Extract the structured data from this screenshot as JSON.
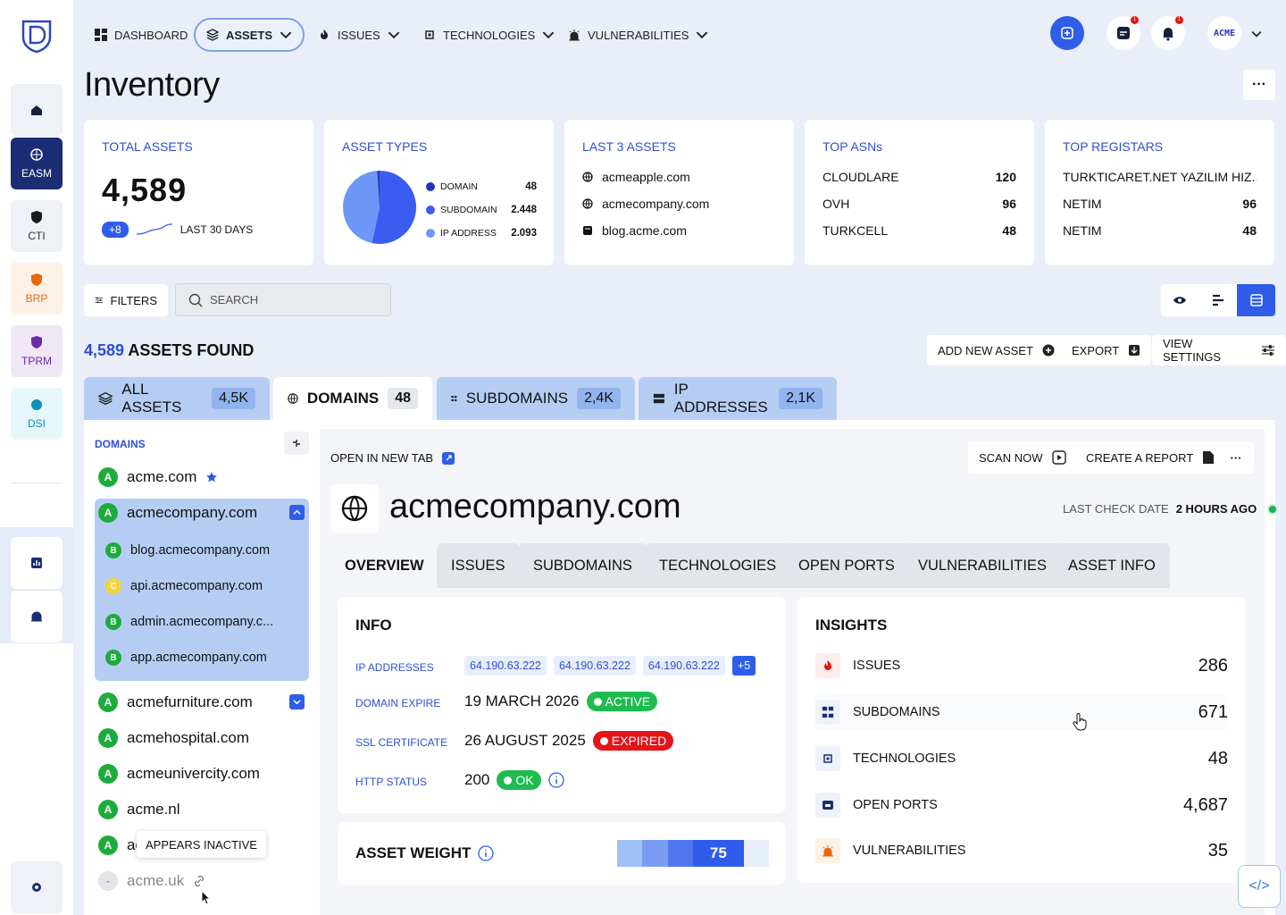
{
  "sidebar": {
    "items": [
      {
        "label": ""
      },
      {
        "label": "EASM"
      },
      {
        "label": "CTI"
      },
      {
        "label": "BRP"
      },
      {
        "label": "TPRM"
      },
      {
        "label": "DSI"
      }
    ]
  },
  "topnav": {
    "dashboard": "DASHBOARD",
    "assets": "ASSETS",
    "issues": "ISSUES",
    "technologies": "TECHNOLOGIES",
    "vulnerabilities": "VULNERABILITIES",
    "msg_badge": "1",
    "bell_badge": "1",
    "avatar": "ACME"
  },
  "page": {
    "title": "Inventory"
  },
  "cards": {
    "total": {
      "title": "TOTAL ASSETS",
      "value": "4,589",
      "delta": "+8",
      "period": "LAST 30 DAYS"
    },
    "types": {
      "title": "ASSET TYPES",
      "rows": [
        {
          "label": "DOMAIN",
          "value": "48",
          "color": "#2236b8"
        },
        {
          "label": "SUBDOMAIN",
          "value": "2.448",
          "color": "#3a5cf0"
        },
        {
          "label": "IP ADDRESS",
          "value": "2.093",
          "color": "#6d96f6"
        }
      ]
    },
    "last3": {
      "title": "LAST 3 ASSETS",
      "items": [
        "acmeapple.com",
        "acmecompany.com",
        "blog.acme.com"
      ]
    },
    "asns": {
      "title": "TOP ASNs",
      "rows": [
        {
          "name": "CLOUDLARE",
          "value": "120"
        },
        {
          "name": "OVH",
          "value": "96"
        },
        {
          "name": "TURKCELL",
          "value": "48"
        }
      ]
    },
    "registrars": {
      "title": "TOP REGISTARS",
      "rows": [
        {
          "name": "TURKTICARET.NET YAZILIM HIZ...",
          "value": "NETIM 96"
        },
        {
          "name": "NETIM",
          "value": "96"
        },
        {
          "name": "NETIM",
          "value": "48"
        }
      ]
    }
  },
  "toolbar": {
    "filters": "FILTERS",
    "search_placeholder": "SEARCH",
    "found_count": "4,589",
    "found_label": "ASSETS FOUND",
    "add": "ADD NEW ASSET",
    "export": "EXPORT",
    "view": "VIEW SETTINGS"
  },
  "tabs": [
    {
      "label": "ALL ASSETS",
      "count": "4,5K"
    },
    {
      "label": "DOMAINS",
      "count": "48"
    },
    {
      "label": "SUBDOMAINS",
      "count": "2,4K"
    },
    {
      "label": "IP ADDRESSES",
      "count": "2,1K"
    }
  ],
  "domains": {
    "header": "DOMAINS",
    "list": [
      {
        "grade": "A",
        "name": "acme.com"
      },
      {
        "grade": "A",
        "name": "acmecompany.com"
      },
      {
        "grade": "A",
        "name": "acmefurniture.com"
      },
      {
        "grade": "A",
        "name": "acmehospital.com"
      },
      {
        "grade": "A",
        "name": "acmeunivercity.com"
      },
      {
        "grade": "A",
        "name": "acme.nl"
      },
      {
        "grade": "A",
        "name": "ac"
      },
      {
        "grade": "-",
        "name": "acme.uk"
      }
    ],
    "subs": [
      {
        "grade": "B",
        "name": "blog.acmecompany.com"
      },
      {
        "grade": "C",
        "name": "api.acmecompany.com"
      },
      {
        "grade": "B",
        "name": "admin.acmecompany.c..."
      },
      {
        "grade": "B",
        "name": "app.acmecompany.com"
      }
    ],
    "tooltip": "APPEARS INACTIVE"
  },
  "detail": {
    "open_tab": "OPEN IN NEW TAB",
    "scan": "SCAN NOW",
    "report": "CREATE A REPORT",
    "name": "acmecompany.com",
    "last_check_label": "LAST CHECK DATE",
    "last_check_value": "2 HOURS AGO",
    "tabs": [
      "OVERVIEW",
      "ISSUES",
      "SUBDOMAINS",
      "TECHNOLOGIES",
      "OPEN PORTS",
      "VULNERABILITIES",
      "ASSET INFO"
    ],
    "info": {
      "title": "INFO",
      "ip_label": "IP ADDRESSES",
      "ips": [
        "64.190.63.222",
        "64.190.63.222",
        "64.190.63.222"
      ],
      "ip_more": "+5",
      "expire_label": "DOMAIN EXPIRE",
      "expire_value": "19 MARCH 2026",
      "expire_status": "ACTIVE",
      "ssl_label": "SSL CERTIFICATE",
      "ssl_value": "26 AUGUST 2025",
      "ssl_status": "EXPIRED",
      "http_label": "HTTP STATUS",
      "http_value": "200",
      "http_status": "OK"
    },
    "weight": {
      "title": "ASSET WEIGHT",
      "value": "75"
    },
    "insights": {
      "title": "INSIGHTS",
      "rows": [
        {
          "label": "ISSUES",
          "value": "286"
        },
        {
          "label": "SUBDOMAINS",
          "value": "671"
        },
        {
          "label": "TECHNOLOGIES",
          "value": "48"
        },
        {
          "label": "OPEN PORTS",
          "value": "4,687"
        },
        {
          "label": "VULNERABILITIES",
          "value": "35"
        }
      ]
    }
  }
}
